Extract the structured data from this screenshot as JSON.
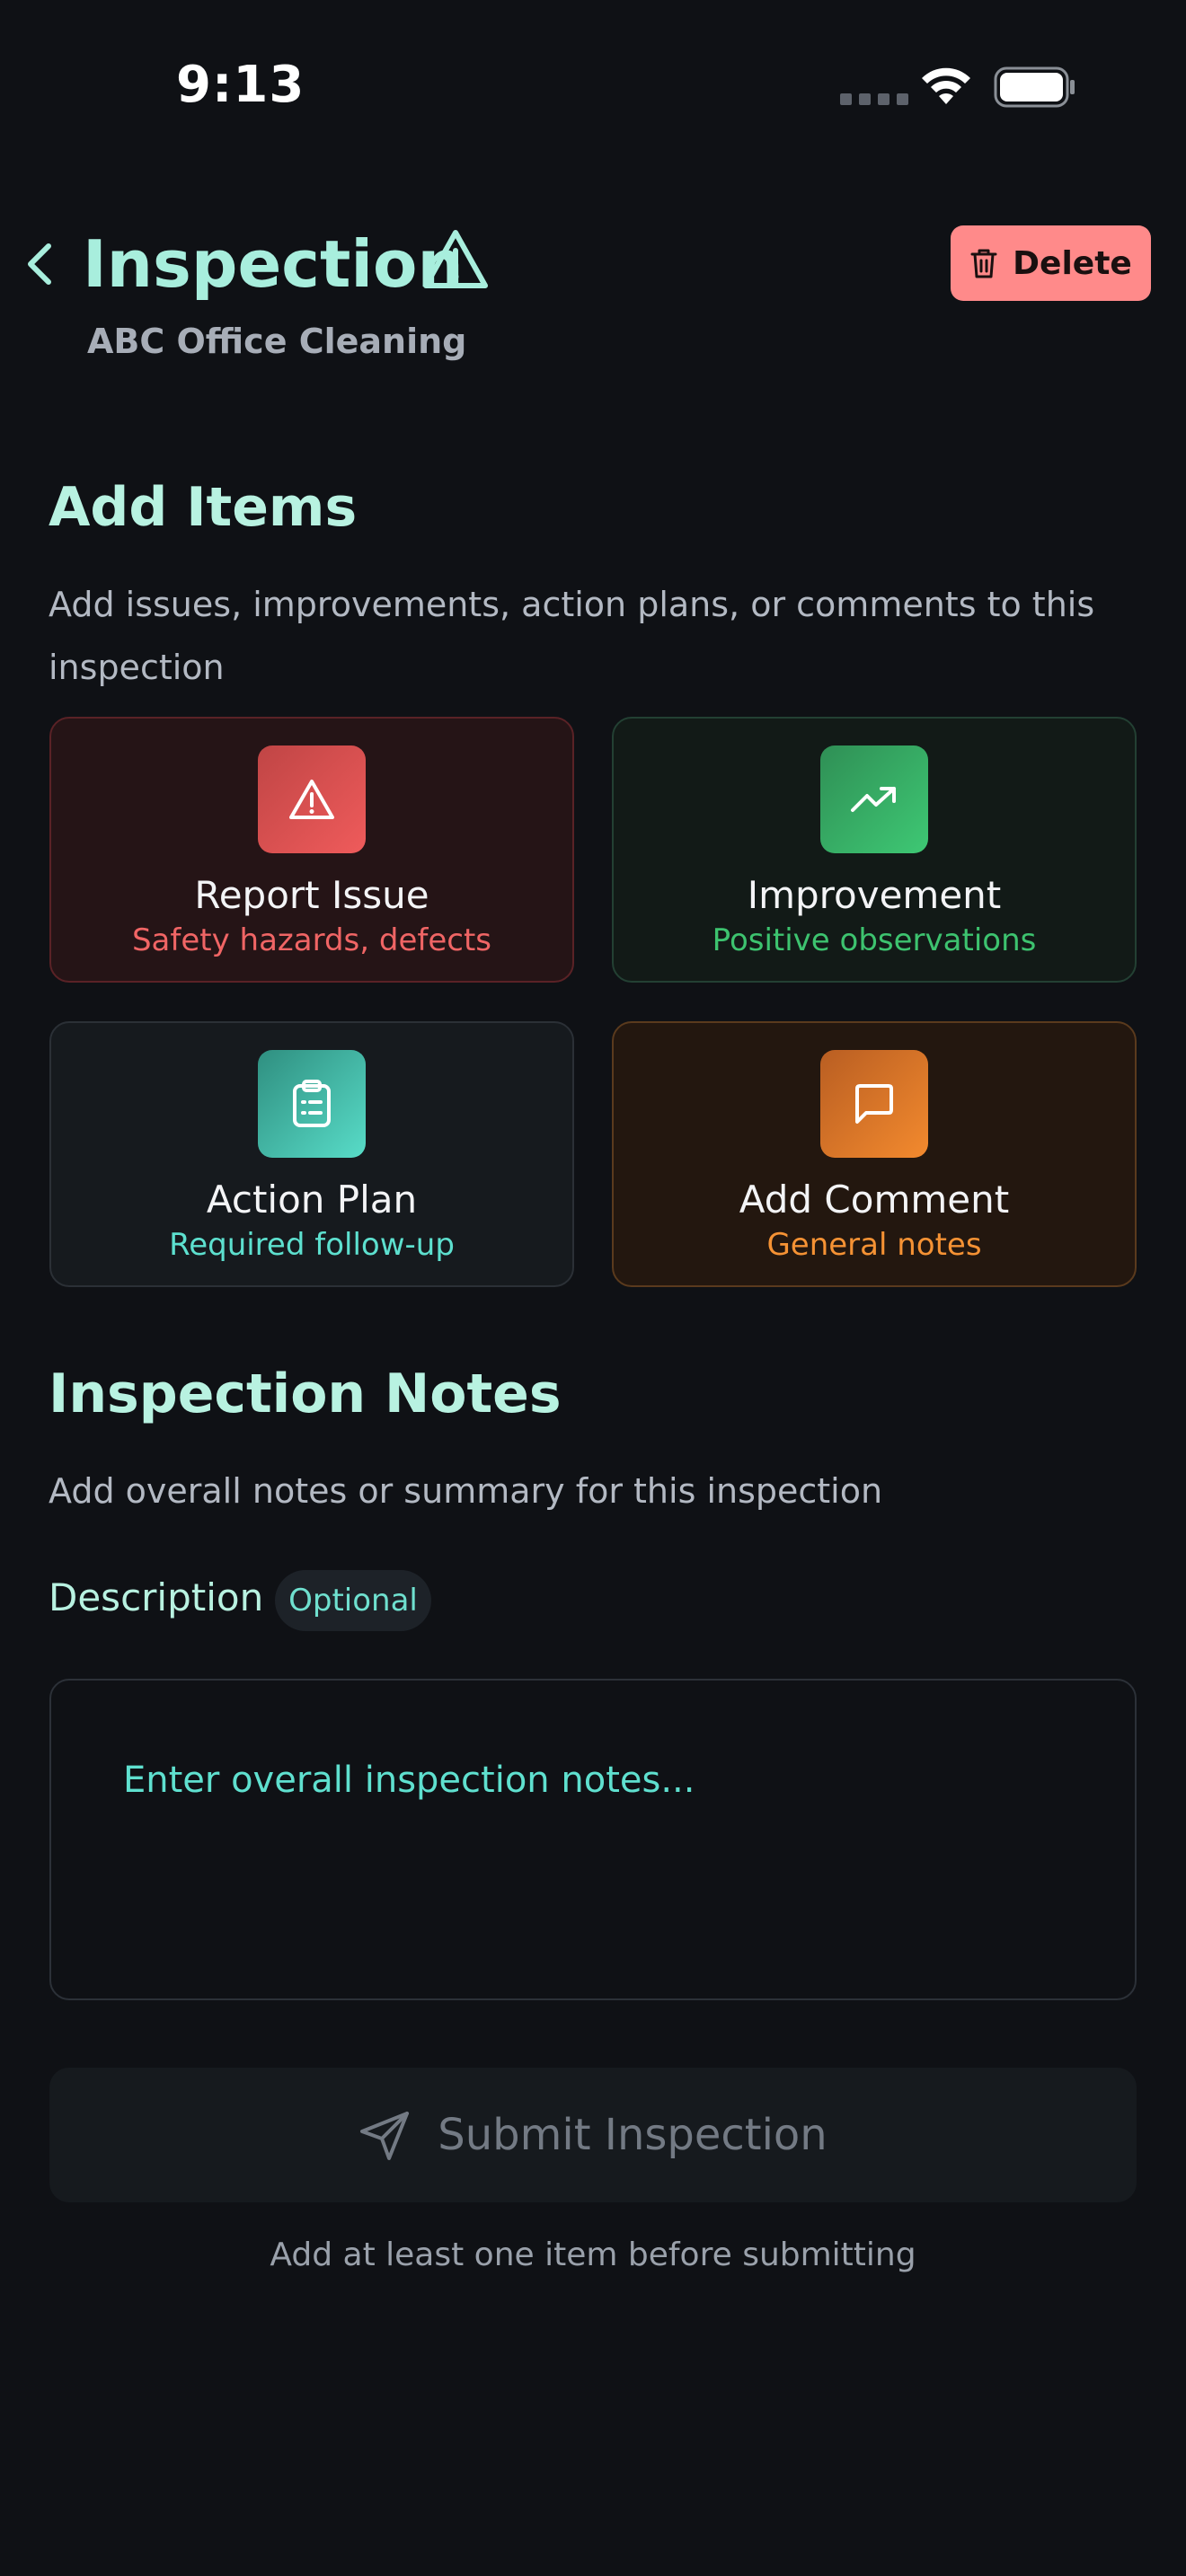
{
  "status_bar": {
    "time": "9:13"
  },
  "header": {
    "title": "Inspection",
    "subtitle": "ABC Office Cleaning",
    "delete_label": "Delete"
  },
  "add_items": {
    "title": "Add Items",
    "description": "Add issues, improvements, action plans, or comments to this inspection",
    "cards": [
      {
        "title": "Report Issue",
        "subtitle": "Safety hazards, defects",
        "icon": "warning-triangle-icon",
        "color": "#ef5b5b"
      },
      {
        "title": "Improvement",
        "subtitle": "Positive observations",
        "icon": "trending-up-icon",
        "color": "#3ec874"
      },
      {
        "title": "Action Plan",
        "subtitle": "Required follow-up",
        "icon": "clipboard-list-icon",
        "color": "#58dcc8"
      },
      {
        "title": "Add Comment",
        "subtitle": "General notes",
        "icon": "message-square-icon",
        "color": "#f38a2e"
      }
    ]
  },
  "notes": {
    "title": "Inspection Notes",
    "description": "Add overall notes or summary for this inspection",
    "field_label": "Description",
    "badge": "Optional",
    "placeholder": "Enter overall inspection notes..."
  },
  "submit": {
    "label": "Submit Inspection",
    "hint": "Add at least one item before submitting"
  },
  "colors": {
    "accent": "#a8eedd",
    "background": "#0f1115",
    "danger": "#ff8a8a"
  }
}
